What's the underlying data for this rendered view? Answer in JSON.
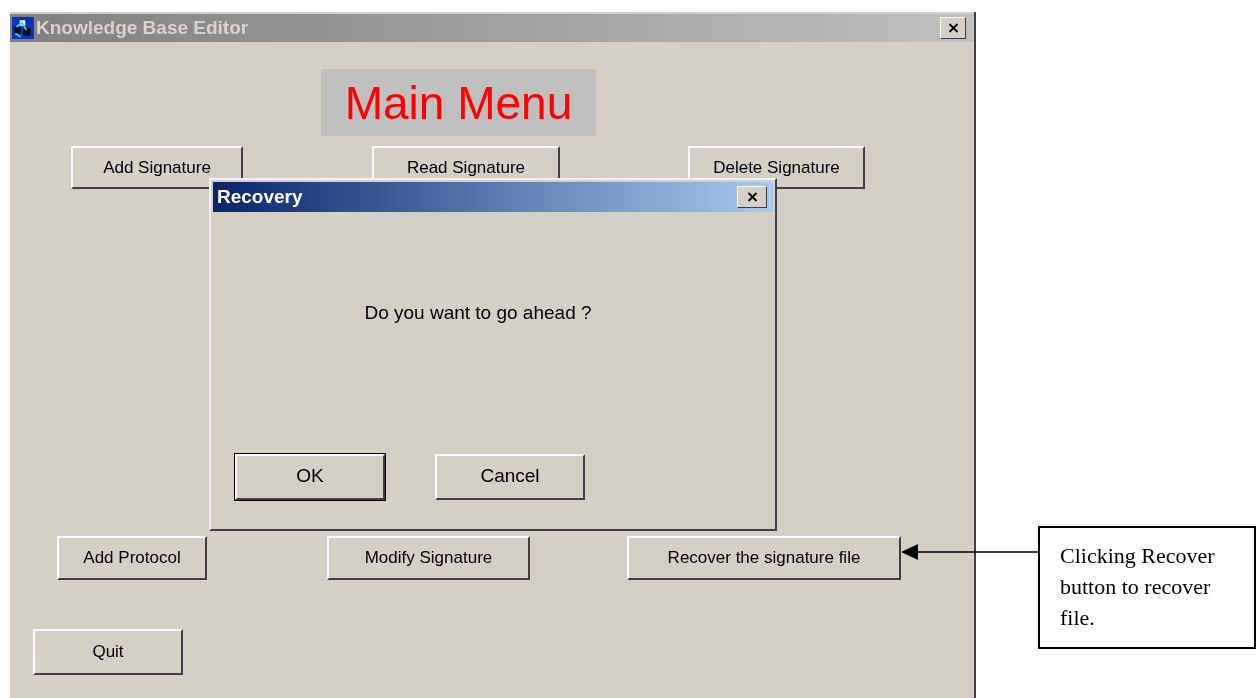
{
  "window": {
    "title": "Knowledge Base Editor",
    "heading": "Main Menu",
    "button_rows": [
      [
        "Add Signature",
        "Read Signature",
        "Delete Signature"
      ],
      [
        "Add Protocol",
        "Modify Signature",
        "Recover the signature file"
      ],
      [
        "Quit"
      ]
    ]
  },
  "dialog": {
    "title": "Recovery",
    "message": "Do you want to go ahead ?",
    "buttons": [
      {
        "label": "OK",
        "default": true
      },
      {
        "label": "Cancel",
        "default": false
      }
    ]
  },
  "annotation": {
    "text": "Clicking Recover button to recover file."
  }
}
